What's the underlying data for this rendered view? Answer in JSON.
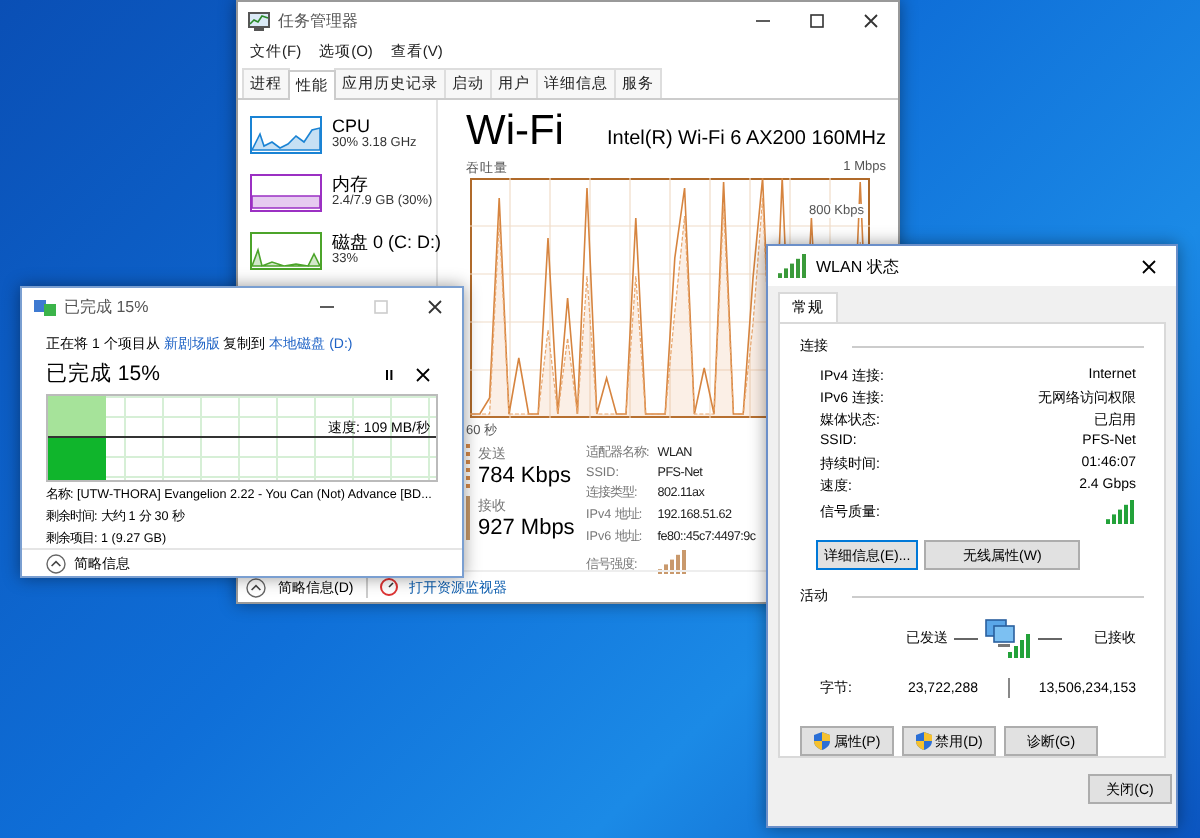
{
  "task_manager": {
    "title": "任务管理器",
    "menu": [
      "文件(F)",
      "选项(O)",
      "查看(V)"
    ],
    "tabs": [
      {
        "label": "进程",
        "selected": false
      },
      {
        "label": "性能",
        "selected": true
      },
      {
        "label": "应用历史记录",
        "selected": false
      },
      {
        "label": "启动",
        "selected": false
      },
      {
        "label": "用户",
        "selected": false
      },
      {
        "label": "详细信息",
        "selected": false
      },
      {
        "label": "服务",
        "selected": false
      }
    ],
    "sidebar": [
      {
        "name": "CPU",
        "detail": "30% 3.18 GHz",
        "color": "#1a83d4"
      },
      {
        "name": "内存",
        "detail": "2.4/7.9 GB (30%)",
        "color": "#9b30c3"
      },
      {
        "name": "磁盘 0 (C: D:)",
        "detail": "33%",
        "color": "#4ca42a"
      }
    ],
    "main": {
      "title": "Wi-Fi",
      "adapter": "Intel(R) Wi-Fi 6 AX200 160MHz",
      "chart_label": "吞吐量",
      "chart_max": "1 Mbps",
      "chart_mid": "800 Kbps",
      "chart_time": "60 秒",
      "send": {
        "label": "发送",
        "value": "784 Kbps"
      },
      "receive": {
        "label": "接收",
        "value": "927 Mbps"
      },
      "properties": [
        {
          "label": "适配器名称:",
          "value": "WLAN",
          "kind": "text"
        },
        {
          "label": "SSID:",
          "value": "PFS-Net",
          "kind": "text"
        },
        {
          "label": "连接类型:",
          "value": "802.11ax",
          "kind": "text"
        },
        {
          "label": "IPv4 地址:",
          "value": "192.168.51.62",
          "kind": "text"
        },
        {
          "label": "IPv6 地址:",
          "value": "fe80::45c7:4497:9c",
          "kind": "text"
        },
        {
          "label": "信号强度:",
          "kind": "signal"
        }
      ]
    },
    "footer": [
      "简略信息(D)",
      "打开资源监视器"
    ]
  },
  "copy_dialog": {
    "title": "已完成 15%",
    "source_text": "正在将 1 个项目从",
    "source_link": "新剧场版",
    "dest_text": "复制到",
    "dest_link": "本地磁盘 (D:)",
    "heading": "已完成 15%",
    "level": 0.15,
    "speed": "速度: 109 MB/秒",
    "details": [
      "名称: [UTW-THORA] Evangelion 2.22 - You Can (Not) Advance [BD...",
      "剩余时间: 大约 1 分 30 秒",
      "剩余项目: 1 (9.27 GB)"
    ],
    "footer": "简略信息"
  },
  "wlan_dialog": {
    "title": "WLAN 状态",
    "tabs": [
      {
        "label": "常规",
        "selected": true
      }
    ],
    "connection_heading": "连接",
    "rows": [
      {
        "label": "IPv4 连接:",
        "value": "Internet",
        "kind": "text"
      },
      {
        "label": "IPv6 连接:",
        "value": "无网络访问权限",
        "kind": "text"
      },
      {
        "label": "媒体状态:",
        "value": "已启用",
        "kind": "text"
      },
      {
        "label": "SSID:",
        "value": "PFS-Net",
        "kind": "text"
      },
      {
        "label": "持续时间:",
        "value": "01:46:07",
        "kind": "text"
      },
      {
        "label": "速度:",
        "value": "2.4 Gbps",
        "kind": "text"
      },
      {
        "label": "信号质量:",
        "kind": "signal"
      }
    ],
    "buttons": [
      "详细信息(E)...",
      "无线属性(W)"
    ],
    "activity_heading": "活动",
    "sent_label": "已发送",
    "received_label": "已接收",
    "bytes_label": "字节:",
    "sent": "23,722,288",
    "received": "13,506,234,153",
    "action_buttons": [
      {
        "label": "属性(P)",
        "shield": true
      },
      {
        "label": "禁用(D)",
        "shield": true
      },
      {
        "label": "诊断(G)",
        "shield": false
      }
    ],
    "close_button": "关闭(C)"
  }
}
